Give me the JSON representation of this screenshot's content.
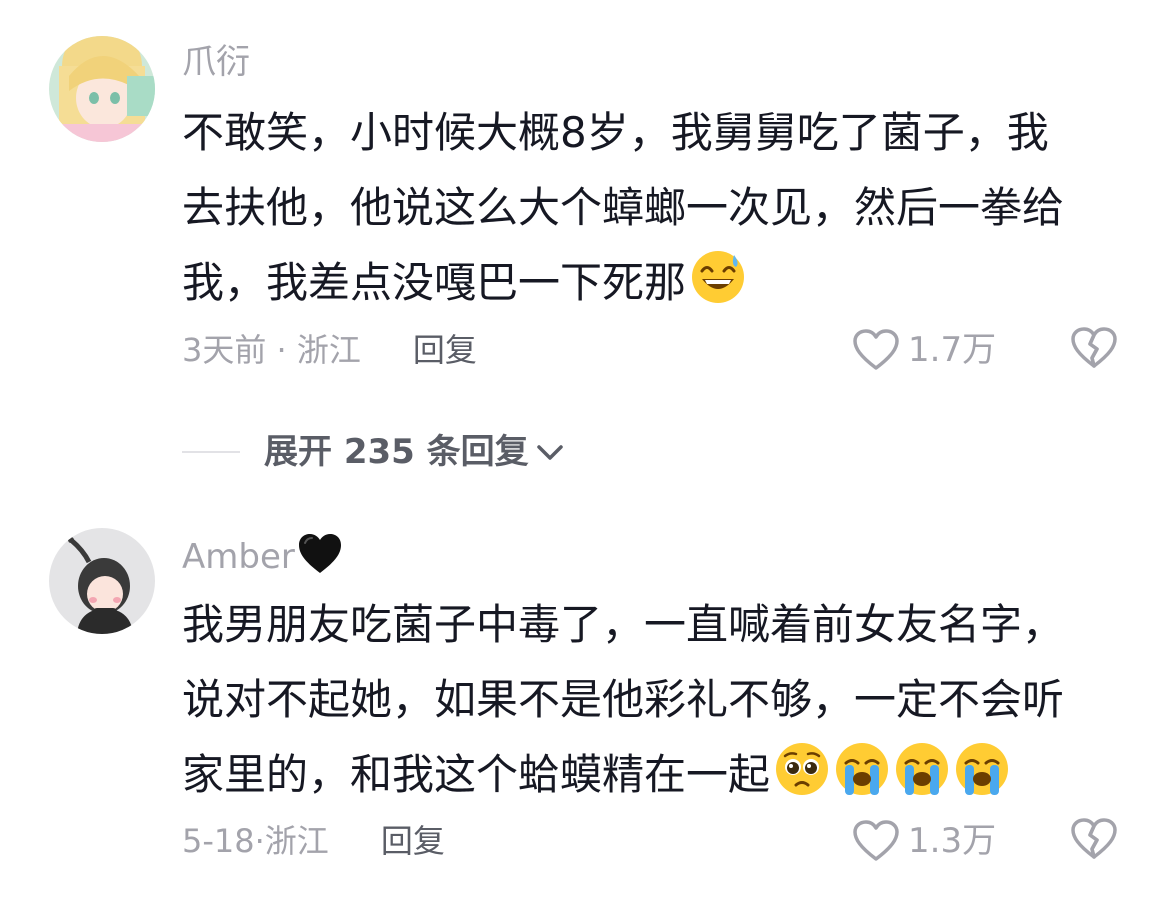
{
  "comments": [
    {
      "username": "爪衍",
      "lines": [
        "不敢笑，小时候大概8岁，我舅舅吃了菌子，我",
        "去扶他，他说这么大个蟑螂一次见，然后一拳给",
        "我，我差点没嘎巴一下死那"
      ],
      "emojis": [
        "grinning-sweat-emoji"
      ],
      "date": "3天前",
      "location": "浙江",
      "meta_sep": " · ",
      "reply_label": "回复",
      "likes": "1.7万"
    },
    {
      "username": "Amber",
      "username_suffix": "black-heart-emoji",
      "lines": [
        "我男朋友吃菌子中毒了，一直喊着前女友名字，",
        "说对不起她，如果不是他彩礼不够，一定不会听",
        "家里的，和我这个蛤蟆精在一起"
      ],
      "emojis": [
        "pleading-face-emoji",
        "loudly-crying-emoji",
        "loudly-crying-emoji",
        "loudly-crying-emoji"
      ],
      "date": "5-18",
      "location": "浙江",
      "meta_sep": "·",
      "reply_label": "回复",
      "likes": "1.3万"
    }
  ],
  "expand_replies": {
    "label": "展开 235 条回复"
  },
  "colors": {
    "text_primary": "#161823",
    "text_secondary": "#a3a3ab",
    "reply_link": "#5a5d66",
    "divider": "#e2e2e6",
    "background": "#ffffff"
  }
}
